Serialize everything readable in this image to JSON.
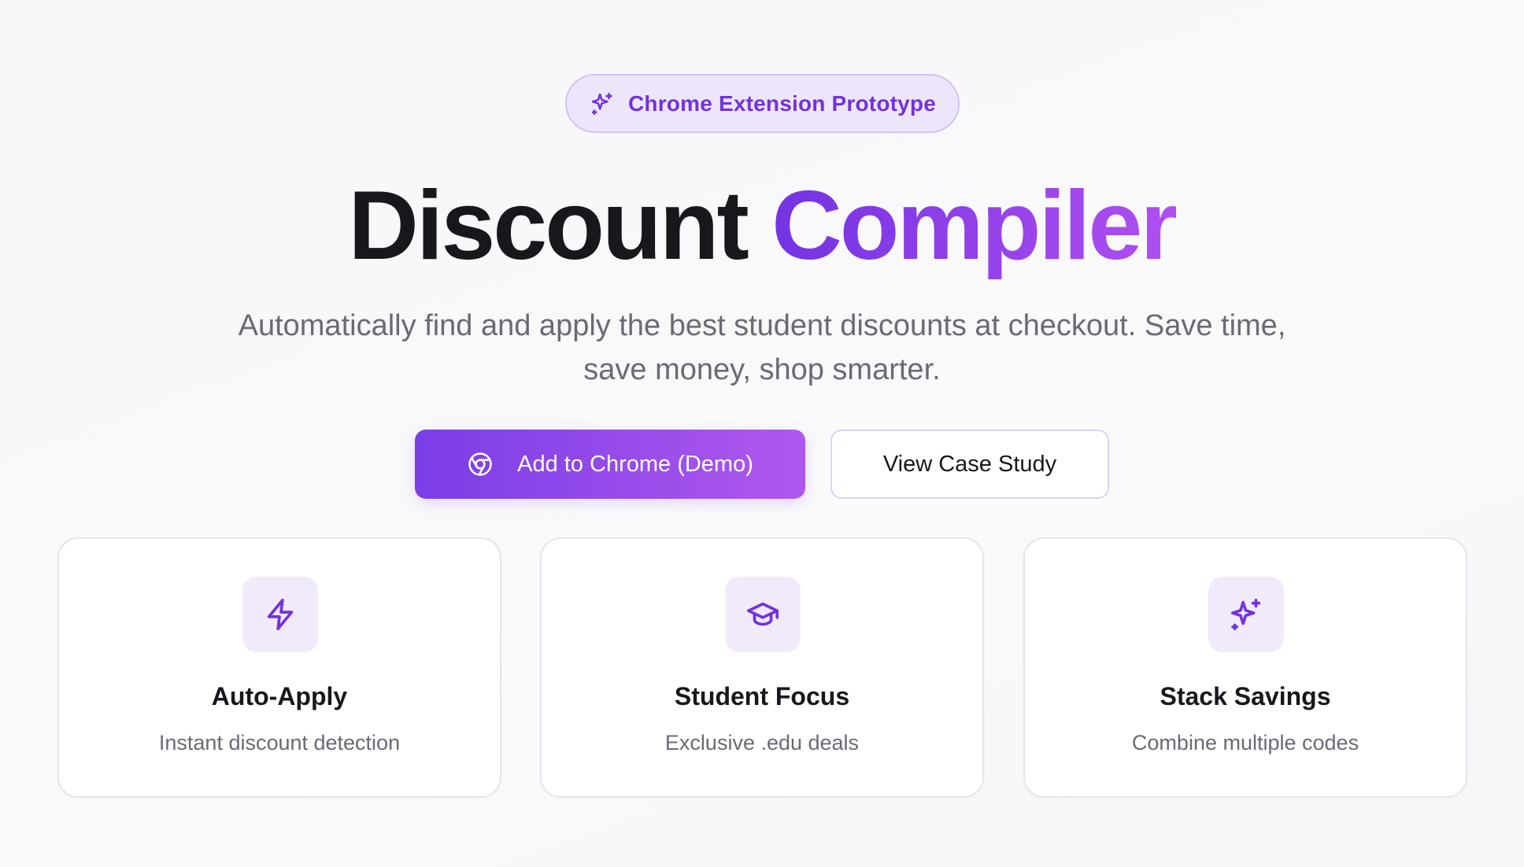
{
  "badge": {
    "icon": "sparkles-icon",
    "label": "Chrome Extension Prototype"
  },
  "hero": {
    "title_part1": "Discount",
    "title_part2": "Compiler",
    "subtitle": "Automatically find and apply the best student discounts at checkout. Save time, save money, shop smarter."
  },
  "actions": {
    "primary_icon": "chrome-icon",
    "primary_label": "Add to Chrome (Demo)",
    "secondary_label": "View Case Study"
  },
  "features": [
    {
      "icon": "lightning-icon",
      "title": "Auto-Apply",
      "description": "Instant discount detection"
    },
    {
      "icon": "graduation-cap-icon",
      "title": "Student Focus",
      "description": "Exclusive .edu deals"
    },
    {
      "icon": "sparkles-icon",
      "title": "Stack Savings",
      "description": "Combine multiple codes"
    }
  ],
  "colors": {
    "accent": "#7232dc",
    "accent_gradient_start": "#7433e3",
    "accent_gradient_end": "#b04ff0",
    "badge_background": "#ede6fb",
    "icon_tile_background": "#f0eafb",
    "text_primary": "#17171c",
    "text_muted": "#6a6a75"
  }
}
